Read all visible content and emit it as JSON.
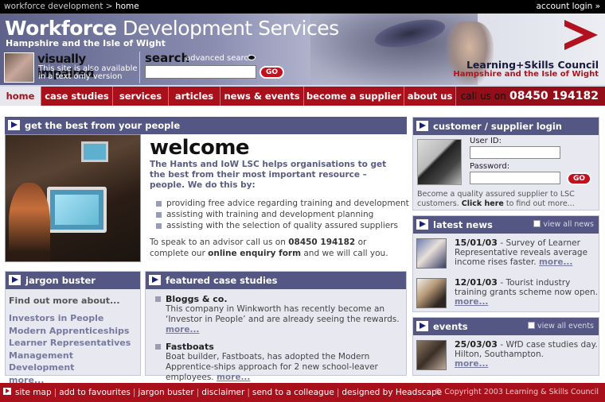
{
  "topbar": {
    "crumb_parent": "workforce development",
    "crumb_sep": ">",
    "crumb_current": "home",
    "account_login": "account login »"
  },
  "header": {
    "title_bold": "Workforce",
    "title_rest": "Development Services",
    "subtitle": "Hampshire and the Isle of Wight",
    "vi_title": "visually impaired",
    "vi_desc": "This site is also available in a text only version",
    "search_label": "search",
    "advanced_search": "advanced search",
    "search_placeholder": "",
    "go_label": "GO",
    "lsc_name": "Learning+Skills Council",
    "lsc_region": "Hampshire and the Isle of Wight"
  },
  "nav": {
    "items": [
      "home",
      "case studies",
      "services",
      "articles",
      "news & events",
      "become a supplier",
      "about us"
    ],
    "phone_label": "call us on",
    "phone": "08450 194182"
  },
  "best": {
    "heading": "get the best from your people",
    "welcome_title": "welcome",
    "intro": "The Hants and IoW LSC helps organisations to get the best from their most important resource – people. We do this by:",
    "bullets": [
      "providing free advice regarding training and development",
      "assisting with training and development planning",
      "assisting with the selection of quality assured suppliers"
    ],
    "cta_before": "To speak to an advisor call us on",
    "cta_phone": "08450 194182",
    "cta_middle": "or complete our",
    "cta_link": "online enquiry form",
    "cta_after": "and we will call you."
  },
  "jargon": {
    "heading": "jargon buster",
    "lead": "Find out more about...",
    "links": [
      "Investors in People",
      "Modern Apprenticeships",
      "Learner Representatives",
      "Management Development",
      "more..."
    ]
  },
  "case_studies": {
    "heading": "featured case studies",
    "items": [
      {
        "title": "Bloggs & co.",
        "desc": "This company in Winkworth has recently become an ‘Investor in People’ and are already seeing the rewards.",
        "more": "more..."
      },
      {
        "title": "Fastboats",
        "desc": "Boat builder, Fastboats, has adopted the Modern Apprentice-ships approach for 2 new school-leaver employees.",
        "more": "more..."
      }
    ]
  },
  "login": {
    "heading": "customer / supplier login",
    "user_label": "User ID:",
    "password_label": "Password:",
    "go_label": "GO",
    "note_before": "Become a quality assured supplier to LSC customers.",
    "note_link": "Click here",
    "note_after": "to find out more..."
  },
  "news": {
    "heading": "latest news",
    "view_all": "view all news",
    "items": [
      {
        "date": "15/01/03",
        "text": "- Survey of Learner Representative reveals average income rises faster.",
        "more": "more..."
      },
      {
        "date": "12/01/03",
        "text": "- Tourist industry training grants scheme now open.",
        "more": "more..."
      }
    ]
  },
  "events": {
    "heading": "events",
    "view_all": "view all events",
    "items": [
      {
        "date": "25/03/03",
        "text": "- WfD case studies day. Hilton, Southampton.",
        "more": "more..."
      }
    ]
  },
  "footer": {
    "links": [
      "site map",
      "add to favourites",
      "jargon buster",
      "disclaimer",
      "send to a colleague",
      "designed by Headscape"
    ],
    "copyright": "© Copyright 2003 Learning & Skills Council"
  },
  "colors": {
    "brand_red": "#a8101c",
    "panel_head": "#545783",
    "panel_bg": "#e8e8f0",
    "link": "#777aa0"
  }
}
